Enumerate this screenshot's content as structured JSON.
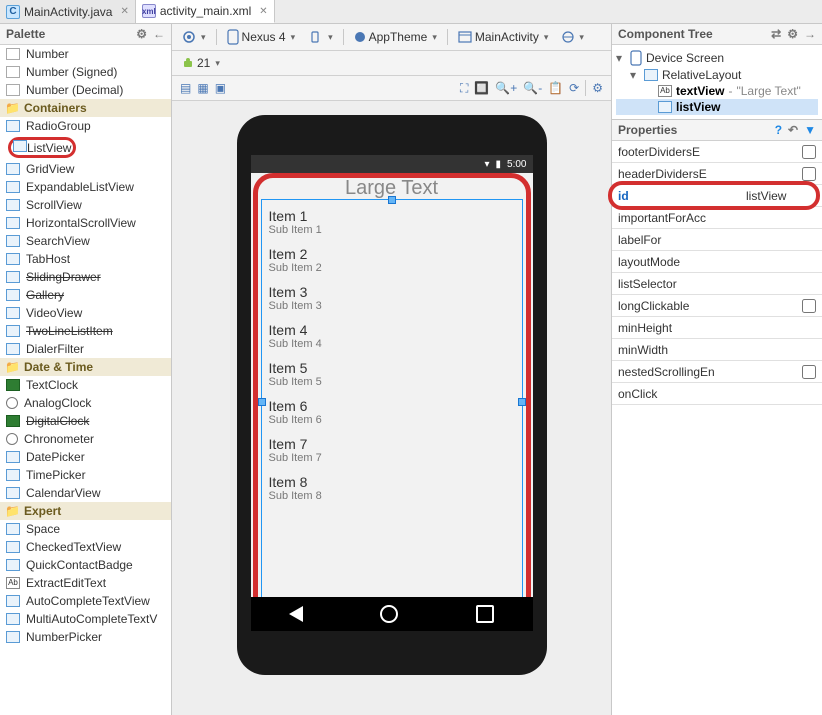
{
  "tabs": [
    {
      "label": "MainActivity.java",
      "icon": "C",
      "active": false
    },
    {
      "label": "activity_main.xml",
      "icon": "xml",
      "active": true
    }
  ],
  "palette": {
    "title": "Palette",
    "groups": [
      {
        "cat": "",
        "items": [
          {
            "label": "Number",
            "ico": "num"
          },
          {
            "label": "Number (Signed)",
            "ico": "num"
          },
          {
            "label": "Number (Decimal)",
            "ico": "num"
          }
        ]
      },
      {
        "cat": "Containers",
        "items": [
          {
            "label": "RadioGroup"
          },
          {
            "label": "ListView",
            "highlight": true
          },
          {
            "label": "GridView"
          },
          {
            "label": "ExpandableListView"
          },
          {
            "label": "ScrollView"
          },
          {
            "label": "HorizontalScrollView"
          },
          {
            "label": "SearchView"
          },
          {
            "label": "TabHost"
          },
          {
            "label": "SlidingDrawer",
            "strike": true
          },
          {
            "label": "Gallery",
            "strike": true
          },
          {
            "label": "VideoView"
          },
          {
            "label": "TwoLineListItem",
            "strike": true
          },
          {
            "label": "DialerFilter"
          }
        ]
      },
      {
        "cat": "Date & Time",
        "items": [
          {
            "label": "TextClock",
            "ico": "green"
          },
          {
            "label": "AnalogClock",
            "ico": "clock"
          },
          {
            "label": "DigitalClock",
            "strike": true,
            "ico": "green"
          },
          {
            "label": "Chronometer",
            "ico": "clock"
          },
          {
            "label": "DatePicker"
          },
          {
            "label": "TimePicker"
          },
          {
            "label": "CalendarView"
          }
        ]
      },
      {
        "cat": "Expert",
        "items": [
          {
            "label": "Space"
          },
          {
            "label": "CheckedTextView"
          },
          {
            "label": "QuickContactBadge"
          },
          {
            "label": "ExtractEditText",
            "ico": "text",
            "glyph": "Ab"
          },
          {
            "label": "AutoCompleteTextView"
          },
          {
            "label": "MultiAutoCompleteTextV"
          },
          {
            "label": "NumberPicker"
          }
        ]
      }
    ]
  },
  "designer": {
    "device": "Nexus 4",
    "theme": "AppTheme",
    "activity": "MainActivity",
    "api": "21",
    "status_time": "5:00",
    "title_text": "Large Text",
    "listitems": [
      {
        "t": "Item 1",
        "s": "Sub Item 1"
      },
      {
        "t": "Item 2",
        "s": "Sub Item 2"
      },
      {
        "t": "Item 3",
        "s": "Sub Item 3"
      },
      {
        "t": "Item 4",
        "s": "Sub Item 4"
      },
      {
        "t": "Item 5",
        "s": "Sub Item 5"
      },
      {
        "t": "Item 6",
        "s": "Sub Item 6"
      },
      {
        "t": "Item 7",
        "s": "Sub Item 7"
      },
      {
        "t": "Item 8",
        "s": "Sub Item 8"
      }
    ]
  },
  "tree": {
    "title": "Component Tree",
    "root": "Device Screen",
    "layout": "RelativeLayout",
    "children": [
      {
        "name": "textView",
        "hint": "\"Large Text\"",
        "ico": "Ab"
      },
      {
        "name": "listView",
        "selected": true
      }
    ]
  },
  "props": {
    "title": "Properties",
    "rows": [
      {
        "k": "footerDividersE",
        "check": true
      },
      {
        "k": "headerDividersE",
        "check": true
      },
      {
        "k": "id",
        "v": "listView",
        "hi": true,
        "ring": true
      },
      {
        "k": "importantForAcc"
      },
      {
        "k": "labelFor"
      },
      {
        "k": "layoutMode"
      },
      {
        "k": "listSelector"
      },
      {
        "k": "longClickable",
        "check": true
      },
      {
        "k": "minHeight"
      },
      {
        "k": "minWidth"
      },
      {
        "k": "nestedScrollingEn",
        "check": true
      },
      {
        "k": "onClick"
      }
    ]
  }
}
